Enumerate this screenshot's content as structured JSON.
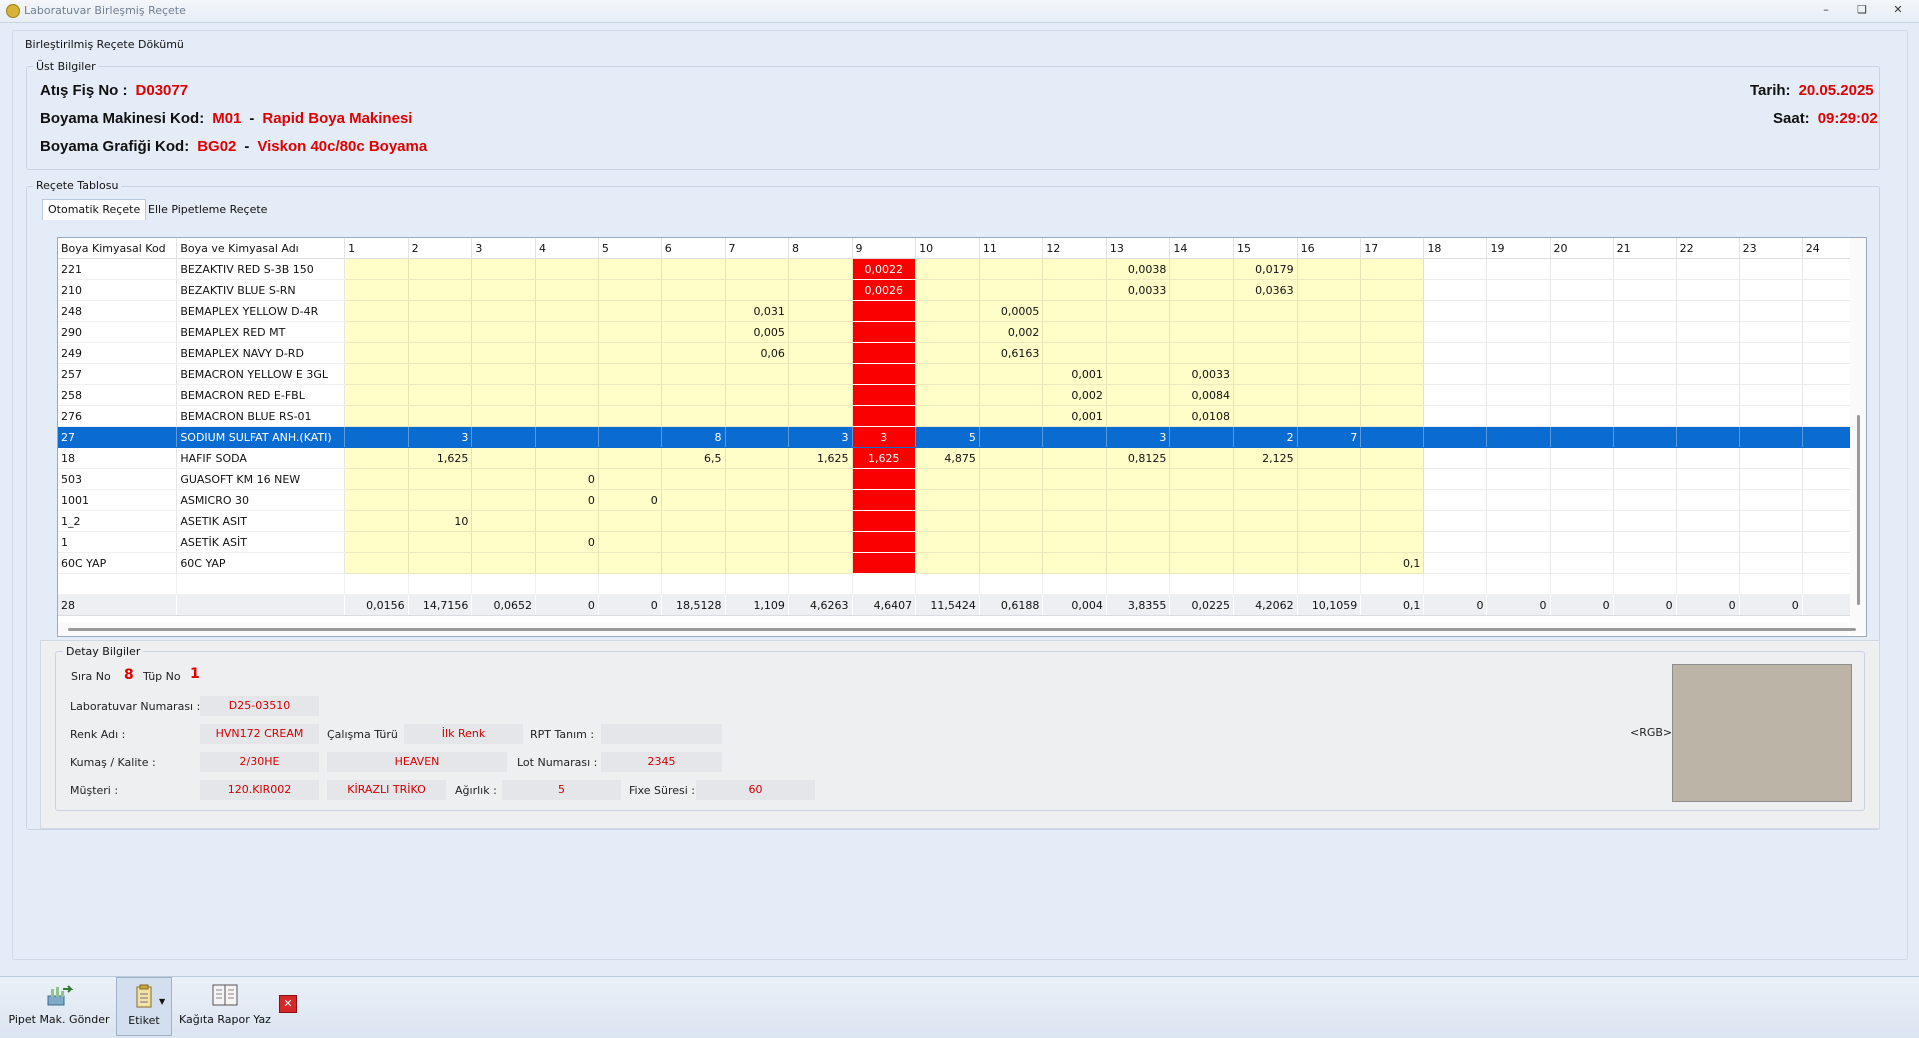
{
  "window": {
    "title": "Laboratuvar Birleşmiş Reçete"
  },
  "outer_group": {
    "label": "Birleştirilmiş Reçete Dökümü"
  },
  "top_info": {
    "label": "Üst Bilgiler",
    "fis_label": "Atış Fiş No :",
    "fis_value": "D03077",
    "machine_label": "Boyama Makinesi Kod:",
    "machine_code": "M01",
    "machine_name": "Rapid Boya Makinesi",
    "graph_label": "Boyama Grafiği Kod:",
    "graph_code": "BG02",
    "graph_name": "Viskon 40c/80c Boyama",
    "date_label": "Tarih:",
    "date_value": "20.05.2025",
    "time_label": "Saat:",
    "time_value": "09:29:02",
    "dash": "-"
  },
  "recipe": {
    "label": "Reçete Tablosu",
    "tabs": [
      "Otomatik Reçete",
      "Elle Pipetleme Reçete"
    ],
    "col_code": "Boya Kimyasal Kod",
    "col_name": "Boya ve Kimyasal Adı",
    "columns": [
      "1",
      "2",
      "3",
      "4",
      "5",
      "6",
      "7",
      "8",
      "9",
      "10",
      "11",
      "12",
      "13",
      "14",
      "15",
      "16",
      "17",
      "18",
      "19",
      "20",
      "21",
      "22",
      "23",
      "24"
    ],
    "rows": [
      {
        "code": "221",
        "name": "BEZAKTIV RED S-3B 150",
        "vals": {
          "9": "0,0022",
          "13": "0,0038",
          "15": "0,0179"
        }
      },
      {
        "code": "210",
        "name": "BEZAKTIV BLUE S-RN",
        "vals": {
          "9": "0,0026",
          "13": "0,0033",
          "15": "0,0363"
        }
      },
      {
        "code": "248",
        "name": "BEMAPLEX YELLOW D-4R",
        "vals": {
          "7": "0,031",
          "11": "0,0005"
        }
      },
      {
        "code": "290",
        "name": "BEMAPLEX RED MT",
        "vals": {
          "7": "0,005",
          "11": "0,002"
        }
      },
      {
        "code": "249",
        "name": "BEMAPLEX NAVY D-RD",
        "vals": {
          "7": "0,06",
          "11": "0,6163"
        }
      },
      {
        "code": "257",
        "name": "BEMACRON YELLOW E 3GL",
        "vals": {
          "12": "0,001",
          "14": "0,0033"
        }
      },
      {
        "code": "258",
        "name": "BEMACRON RED E-FBL",
        "vals": {
          "12": "0,002",
          "14": "0,0084"
        }
      },
      {
        "code": "276",
        "name": "BEMACRON BLUE RS-01",
        "vals": {
          "12": "0,001",
          "14": "0,0108"
        }
      },
      {
        "code": "27",
        "name": "SODIUM SULFAT ANH.(KATI)",
        "selected": true,
        "vals": {
          "2": "3",
          "6": "8",
          "8": "3",
          "9": "3",
          "10": "5",
          "13": "3",
          "15": "2",
          "16": "7"
        }
      },
      {
        "code": "18",
        "name": "HAFIF SODA",
        "vals": {
          "2": "1,625",
          "6": "6,5",
          "8": "1,625",
          "9": "1,625",
          "10": "4,875",
          "13": "0,8125",
          "15": "2,125"
        }
      },
      {
        "code": "503",
        "name": "GUASOFT KM 16 NEW",
        "vals": {
          "4": "0"
        }
      },
      {
        "code": "1001",
        "name": "ASMICRO 30",
        "vals": {
          "4": "0",
          "5": "0"
        }
      },
      {
        "code": "1_2",
        "name": "ASETIK ASIT",
        "vals": {
          "2": "10"
        }
      },
      {
        "code": "1",
        "name": "ASETİK ASİT",
        "vals": {
          "4": "0"
        }
      },
      {
        "code": "60C YAP",
        "name": "60C YAP",
        "vals": {
          "17": "0,1"
        }
      }
    ],
    "totals": {
      "code": "28",
      "vals": [
        "0,0156",
        "14,7156",
        "0,0652",
        "0",
        "0",
        "18,5128",
        "1,109",
        "4,6263",
        "4,6407",
        "11,5424",
        "0,6188",
        "0,004",
        "3,8355",
        "0,0225",
        "4,2062",
        "10,1059",
        "0,1",
        "0",
        "0",
        "0",
        "0",
        "0",
        "0",
        ""
      ]
    },
    "red_column": "9",
    "yellow_columns": 17
  },
  "detail": {
    "label": "Detay Bilgiler",
    "sira_label": "Sıra No",
    "sira_value": "8",
    "tup_label": "Tüp No",
    "tup_value": "1",
    "lab_no_label": "Laboratuvar Numarası :",
    "lab_no_value": "D25-03510",
    "renk_label": "Renk Adı :",
    "renk_value": "HVN172 CREAM",
    "calisma_label": "Çalışma Türü",
    "calisma_value": "İlk Renk",
    "rpt_label": "RPT Tanım :",
    "rpt_value": "",
    "kumas_label": "Kumaş / Kalite :",
    "kumas_value": "2/30HE",
    "kumas_value2": "HEAVEN",
    "lot_label": "Lot Numarası :",
    "lot_value": "2345",
    "musteri_label": "Müşteri :",
    "musteri_code": "120.KIR002",
    "musteri_name": "KİRAZLI TRİKO",
    "agirlik_label": "Ağırlık :",
    "agirlik_value": "5",
    "fixe_label": "Fixe Süresi :",
    "fixe_value": "60",
    "rgb_label": "<RGB>",
    "swatch_color": "#bcb5a7"
  },
  "toolbar": {
    "pipet": "Pipet Mak. Gönder",
    "etiket": "Etiket",
    "rapor": "Kağıta Rapor Yaz"
  }
}
